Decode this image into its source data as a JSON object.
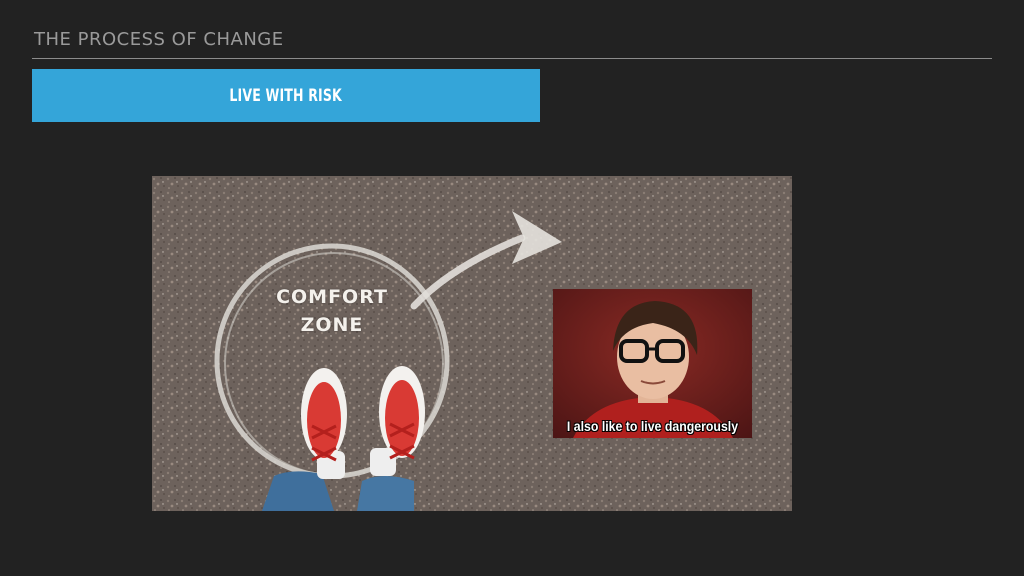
{
  "slide": {
    "title": "THE PROCESS OF CHANGE",
    "banner_label": "LIVE WITH RISK"
  },
  "photo": {
    "chalk_line1": "COMFORT",
    "chalk_line2": "ZONE"
  },
  "meme": {
    "caption": "I also like to live dangerously"
  },
  "colors": {
    "background": "#222222",
    "banner": "#34a5d9",
    "title_text": "#9a9a9a"
  }
}
